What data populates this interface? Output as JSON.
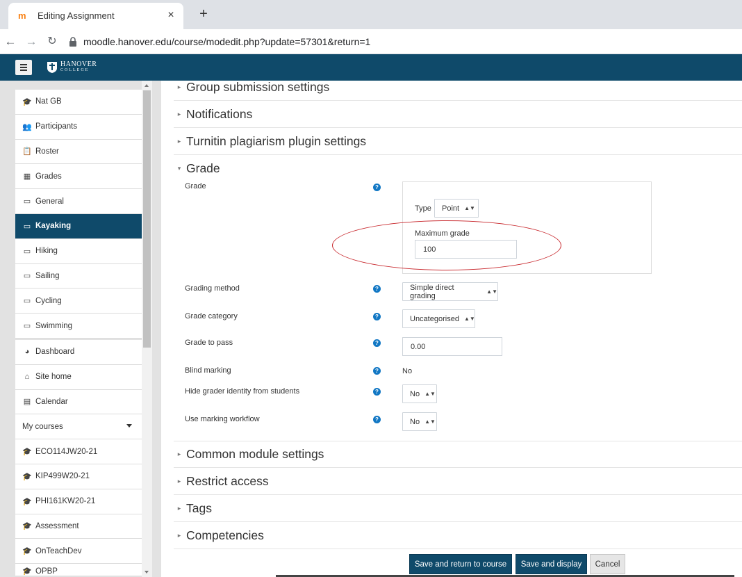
{
  "browser": {
    "tab_title": "Editing Assignment",
    "tab_favicon": "moodle-icon",
    "close_glyph": "×",
    "new_tab_glyph": "+",
    "url": "moodle.hanover.edu/course/modedit.php?update=57301&return=1"
  },
  "header": {
    "logo_text": "HANOVER",
    "logo_sub": "COLLEGE"
  },
  "sidebar": {
    "items": [
      {
        "label": "Nat GB",
        "icon": "graduation-cap-icon",
        "glyph": "🎓"
      },
      {
        "label": "Participants",
        "icon": "users-icon",
        "glyph": "👥"
      },
      {
        "label": "Roster",
        "icon": "clipboard-icon",
        "glyph": "📋"
      },
      {
        "label": "Grades",
        "icon": "table-icon",
        "glyph": "▦"
      },
      {
        "label": "General",
        "icon": "folder-icon",
        "glyph": "▭"
      },
      {
        "label": "Kayaking",
        "icon": "folder-icon",
        "glyph": "▭"
      },
      {
        "label": "Hiking",
        "icon": "folder-icon",
        "glyph": "▭"
      },
      {
        "label": "Sailing",
        "icon": "folder-icon",
        "glyph": "▭"
      },
      {
        "label": "Cycling",
        "icon": "folder-icon",
        "glyph": "▭"
      },
      {
        "label": "Swimming",
        "icon": "folder-icon",
        "glyph": "▭"
      },
      {
        "label": "Dashboard",
        "icon": "dashboard-icon",
        "glyph": "◕"
      },
      {
        "label": "Site home",
        "icon": "home-icon",
        "glyph": "⌂"
      },
      {
        "label": "Calendar",
        "icon": "calendar-icon",
        "glyph": "▤"
      },
      {
        "label": "My courses",
        "icon": "",
        "glyph": ""
      },
      {
        "label": "ECO114JW20-21",
        "icon": "graduation-cap-icon",
        "glyph": "🎓"
      },
      {
        "label": "KIP499W20-21",
        "icon": "graduation-cap-icon",
        "glyph": "🎓"
      },
      {
        "label": "PHI161KW20-21",
        "icon": "graduation-cap-icon",
        "glyph": "🎓"
      },
      {
        "label": "Assessment",
        "icon": "graduation-cap-icon",
        "glyph": "🎓"
      },
      {
        "label": "OnTeachDev",
        "icon": "graduation-cap-icon",
        "glyph": "🎓"
      },
      {
        "label": "OPBP",
        "icon": "graduation-cap-icon",
        "glyph": "🎓"
      }
    ],
    "active_label": "Kayaking"
  },
  "sections": {
    "group_submission": "Group submission settings",
    "notifications": "Notifications",
    "turnitin": "Turnitin plagiarism plugin settings",
    "grade": "Grade",
    "common_module": "Common module settings",
    "restrict_access": "Restrict access",
    "tags": "Tags",
    "competencies": "Competencies"
  },
  "grade_form": {
    "grade_label": "Grade",
    "type_label": "Type",
    "type_value": "Point",
    "max_grade_label": "Maximum grade",
    "max_grade_value": "100",
    "grading_method_label": "Grading method",
    "grading_method_value": "Simple direct grading",
    "grade_category_label": "Grade category",
    "grade_category_value": "Uncategorised",
    "grade_to_pass_label": "Grade to pass",
    "grade_to_pass_value": "0.00",
    "blind_marking_label": "Blind marking",
    "blind_marking_value": "No",
    "hide_grader_label": "Hide grader identity from students",
    "hide_grader_value": "No",
    "marking_workflow_label": "Use marking workflow",
    "marking_workflow_value": "No",
    "help_glyph": "?"
  },
  "buttons": {
    "save_return": "Save and return to course",
    "save_display": "Save and display",
    "cancel": "Cancel"
  },
  "colors": {
    "header": "#0f4a6a",
    "active_nav": "#0f4a6a",
    "help_icon": "#1177c4",
    "highlight_circle": "#c8282d"
  }
}
